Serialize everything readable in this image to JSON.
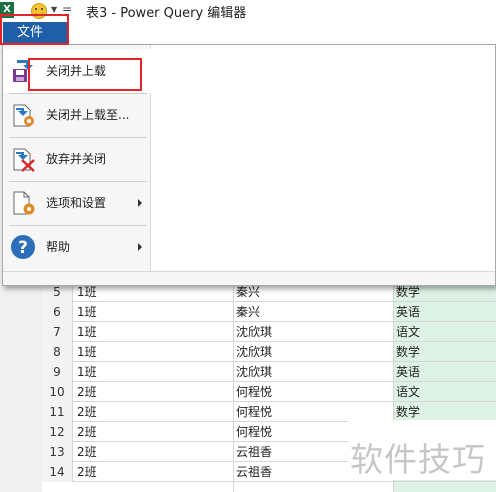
{
  "window": {
    "title": "表3 - Power Query 编辑器",
    "excel_icon": "X"
  },
  "file_menu": {
    "tab_label": "文件",
    "items": [
      {
        "label": "关闭并上载",
        "icon": "close-and-load-icon",
        "has_submenu": false
      },
      {
        "label": "关闭并上载至...",
        "icon": "close-and-load-to-icon",
        "has_submenu": false
      },
      {
        "label": "放弃并关闭",
        "icon": "discard-and-close-icon",
        "has_submenu": false
      },
      {
        "label": "选项和设置",
        "icon": "options-settings-icon",
        "has_submenu": true
      },
      {
        "label": "帮助",
        "icon": "help-icon",
        "has_submenu": true
      }
    ]
  },
  "grid": {
    "rows": [
      {
        "num": "5",
        "class": "1班",
        "name": "秦兴",
        "subject": "数学"
      },
      {
        "num": "6",
        "class": "1班",
        "name": "秦兴",
        "subject": "英语"
      },
      {
        "num": "7",
        "class": "1班",
        "name": "沈欣琪",
        "subject": "语文"
      },
      {
        "num": "8",
        "class": "1班",
        "name": "沈欣琪",
        "subject": "数学"
      },
      {
        "num": "9",
        "class": "1班",
        "name": "沈欣琪",
        "subject": "英语"
      },
      {
        "num": "10",
        "class": "2班",
        "name": "何程悦",
        "subject": "语文"
      },
      {
        "num": "11",
        "class": "2班",
        "name": "何程悦",
        "subject": "数学"
      },
      {
        "num": "12",
        "class": "2班",
        "name": "何程悦",
        "subject": ""
      },
      {
        "num": "13",
        "class": "2班",
        "name": "云祖香",
        "subject": ""
      },
      {
        "num": "14",
        "class": "2班",
        "name": "云祖香",
        "subject": ""
      }
    ]
  },
  "watermark": "软件技巧",
  "colors": {
    "file_tab": "#1f5fa9",
    "highlight_border": "#e0262a",
    "green_column": "#ddf1e4"
  }
}
